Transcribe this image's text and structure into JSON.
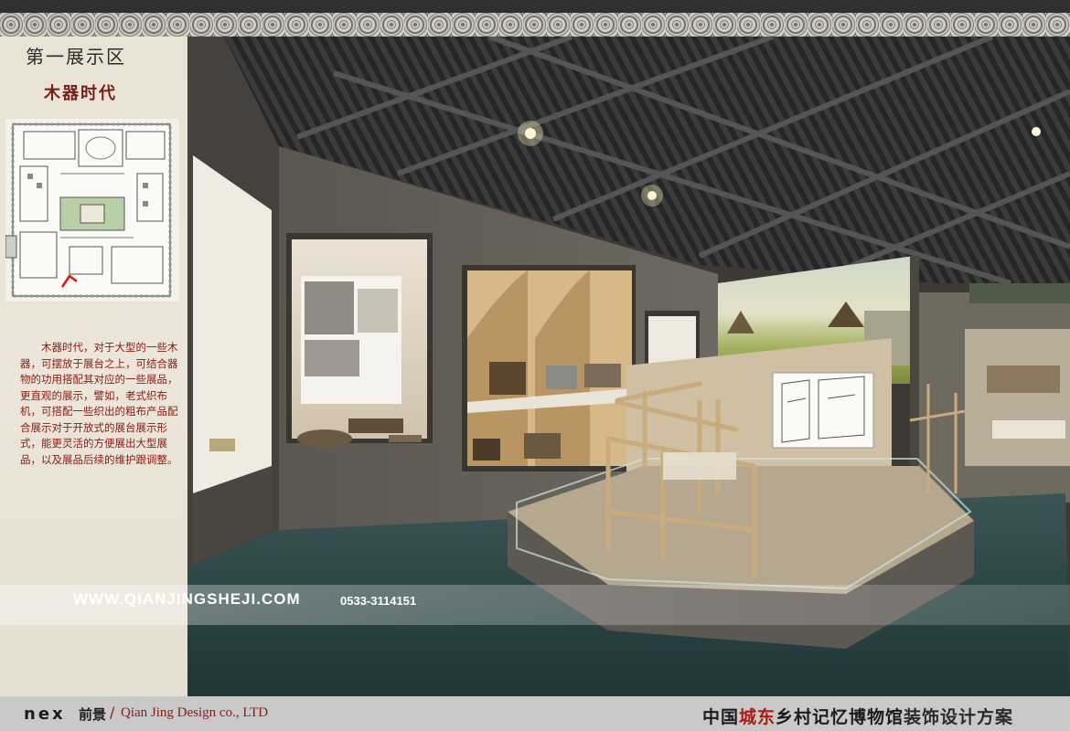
{
  "left_panel": {
    "zone_title": "第一展示区",
    "zone_subtitle": "木器时代",
    "description": "木器时代，对于大型的一些木器，可摆放于展台之上，可结合器物的功用搭配其对应的一些展品，更直观的展示，譬如，老式织布机，可搭配一些织出的粗布产品配合展示对于开放式的展台展示形式，能更灵活的方便展出大型展品，以及展品后续的维护跟调整。"
  },
  "watermark": {
    "url": "WWW.QIANJINGSHEJI.COM",
    "phone": "0533-3114151"
  },
  "footer": {
    "logo": "nex",
    "logo_cn": "前景",
    "separator": "/",
    "company_en": "Qian Jing Design co., LTD",
    "project_prefix": "中国",
    "project_highlight": "城东",
    "project_name": "乡村记忆博物馆",
    "project_suffix": "装饰设计方案"
  },
  "colors": {
    "accent_red": "#8b1a10",
    "floor": "#2f4a4c",
    "ceiling": "#2b2b2b"
  }
}
